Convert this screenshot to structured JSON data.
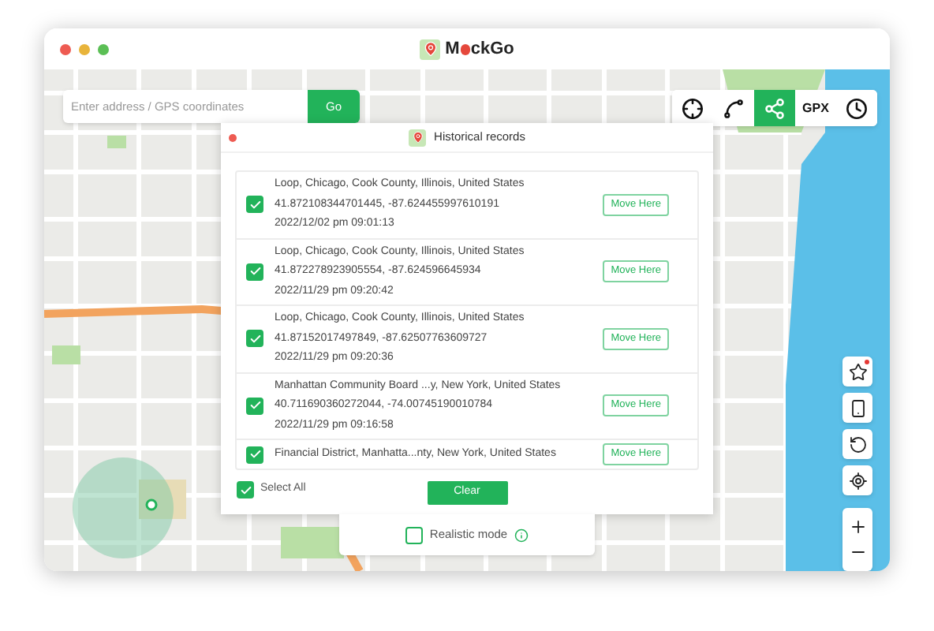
{
  "window": {
    "title_parts": [
      "M",
      "ckGo"
    ]
  },
  "search": {
    "placeholder": "Enter address / GPS coordinates",
    "button": "Go"
  },
  "toolbar": [
    {
      "kind": "crosshair",
      "selected": false
    },
    {
      "kind": "route",
      "selected": false
    },
    {
      "kind": "share",
      "selected": true
    },
    {
      "kind": "text",
      "label": "GPX",
      "selected": false
    },
    {
      "kind": "clock",
      "selected": false
    }
  ],
  "dialog": {
    "title": "Historical records",
    "records": [
      {
        "address": "Loop, Chicago, Cook County, Illinois, United States",
        "coordinates": "41.872108344701445, -87.624455997610191",
        "time": "2022/12/02 pm 09:01:13",
        "checked": true,
        "button": "Move Here"
      },
      {
        "address": "Loop, Chicago, Cook County, Illinois, United States",
        "coordinates": "41.872278923905554, -87.624596645934",
        "time": "2022/11/29 pm 09:20:42",
        "checked": true,
        "button": "Move Here"
      },
      {
        "address": "Loop, Chicago, Cook County, Illinois, United States",
        "coordinates": "41.87152017497849, -87.62507763609727",
        "time": "2022/11/29 pm 09:20:36",
        "checked": true,
        "button": "Move Here"
      },
      {
        "address": "Manhattan Community Board ...y, New York, United States",
        "coordinates": "40.711690360272044, -74.00745190010784",
        "time": "2022/11/29 pm 09:16:58",
        "checked": true,
        "button": "Move Here"
      },
      {
        "address": "Financial District, Manhatta...nty, New York, United States",
        "checked": true,
        "button": "Move Here"
      }
    ],
    "select_all": {
      "label": "Select All",
      "checked": true
    },
    "clear_button": "Clear"
  },
  "realistic_mode": {
    "label": "Realistic mode",
    "checked": false
  },
  "map_controls": [
    {
      "kind": "star"
    },
    {
      "kind": "device"
    },
    {
      "kind": "rotate"
    },
    {
      "kind": "locate"
    },
    {
      "kind": "zoom"
    }
  ]
}
